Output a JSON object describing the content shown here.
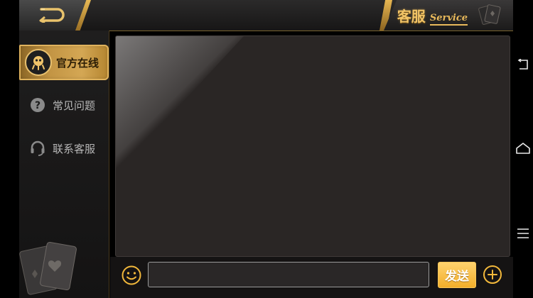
{
  "header": {
    "title": "客服",
    "subtitle": "Service"
  },
  "sidebar": {
    "items": [
      {
        "label": "官方在线",
        "icon": "official-online-icon",
        "active": true
      },
      {
        "label": "常见问题",
        "icon": "question-icon",
        "active": false
      },
      {
        "label": "联系客服",
        "icon": "headset-icon",
        "active": false
      }
    ]
  },
  "composer": {
    "input_value": "",
    "input_placeholder": "",
    "send_label": "发送"
  },
  "icons": {
    "back": "back-icon",
    "emoji": "smile-icon",
    "add": "plus-icon",
    "system_nav": [
      "system-back-icon",
      "system-home-icon",
      "system-menu-icon"
    ]
  },
  "colors": {
    "accent_gold": "#e6b652",
    "send_button": "#f4b12f",
    "panel_bg": "#2a2625"
  }
}
